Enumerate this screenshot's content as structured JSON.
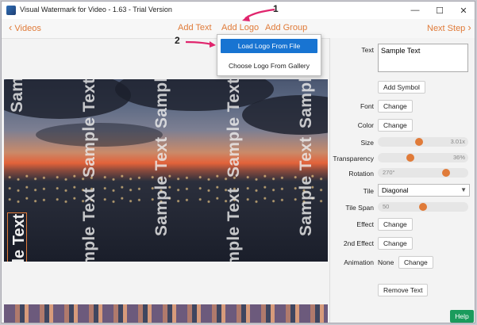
{
  "window": {
    "title": "Visual Watermark for Video - 1.63 - Trial Version",
    "minimize_glyph": "—",
    "maximize_glyph": "☐",
    "close_glyph": "✕"
  },
  "nav": {
    "back_label": "Videos",
    "back_chevron": "‹",
    "add_text": "Add Text",
    "add_logo": "Add Logo",
    "add_group": "Add Group",
    "next_label": "Next Step",
    "next_chevron": "›"
  },
  "logo_menu": {
    "items": [
      "Load Logo From File",
      "Choose Logo From Gallery"
    ]
  },
  "callouts": [
    "1",
    "2"
  ],
  "watermark": {
    "text": "Sample Text"
  },
  "panel": {
    "text_label": "Text",
    "text_value": "Sample Text",
    "add_symbol": "Add Symbol",
    "font_label": "Font",
    "change": "Change",
    "color_label": "Color",
    "size_label": "Size",
    "size_value": "3.01x",
    "size_level": 0.46,
    "transparency_label": "Transparency",
    "transparency_value": "36%",
    "transparency_level": 0.36,
    "rotation_label": "Rotation",
    "rotation_value": "270°",
    "rotation_level": 0.75,
    "tile_label": "Tile",
    "tile_value": "Diagonal",
    "tile_span_label": "Tile Span",
    "tile_span_value": "50",
    "tile_span_level": 0.5,
    "effect_label": "Effect",
    "effect2_label": "2nd Effect",
    "animation_label": "Animation",
    "animation_value": "None",
    "remove_text": "Remove Text"
  },
  "help": "Help",
  "colors": {
    "accent": "#e07b39",
    "menu_highlight": "#1874d2",
    "help_button": "#1a9b5c"
  },
  "icons": [
    "app-icon",
    "chevron-left-icon",
    "chevron-right-icon",
    "dropdown-arrow-icon"
  ]
}
